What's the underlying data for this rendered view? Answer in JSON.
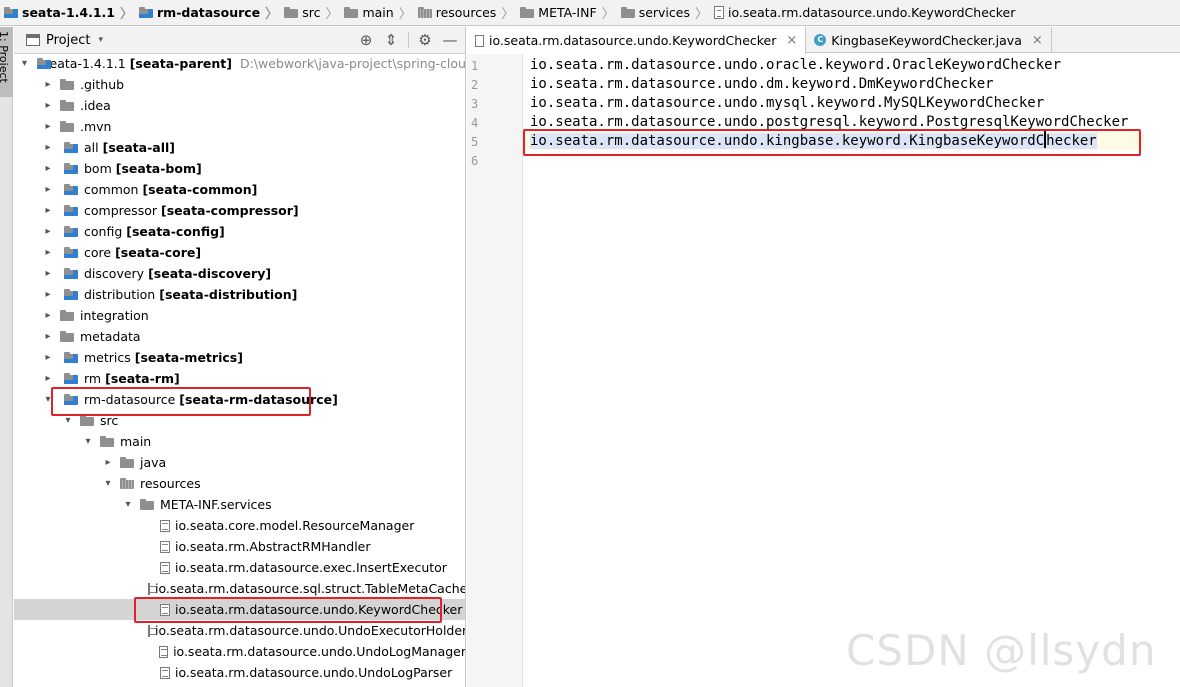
{
  "breadcrumb": [
    {
      "label": "seata-1.4.1.1",
      "icon": "module-folder-icon",
      "bold": true
    },
    {
      "label": "rm-datasource",
      "icon": "module-folder-icon",
      "bold": true
    },
    {
      "label": "src",
      "icon": "folder-icon",
      "bold": false
    },
    {
      "label": "main",
      "icon": "folder-icon",
      "bold": false
    },
    {
      "label": "resources",
      "icon": "resources-folder-icon",
      "bold": false
    },
    {
      "label": "META-INF",
      "icon": "folder-icon",
      "bold": false
    },
    {
      "label": "services",
      "icon": "folder-icon",
      "bold": false
    },
    {
      "label": "io.seata.rm.datasource.undo.KeywordChecker",
      "icon": "file-icon",
      "bold": false
    }
  ],
  "side_tool": {
    "label": "1: Project"
  },
  "project_panel": {
    "title": "Project",
    "dropdown_glyph": "▾",
    "buttons": {
      "locate": "⊕",
      "collapse": "⇕",
      "settings": "⚙",
      "hide": "—"
    }
  },
  "tree": [
    {
      "arrow": "▾",
      "depth": 0,
      "name": "seata-1.4.1.1",
      "module": "[seata-parent]",
      "path": "D:\\webwork\\java-project\\spring-cloud-alibaba",
      "icon": "module"
    },
    {
      "arrow": "▸",
      "depth": 1,
      "name": ".github",
      "module": "",
      "path": "",
      "icon": "folder"
    },
    {
      "arrow": "▸",
      "depth": 1,
      "name": ".idea",
      "module": "",
      "path": "",
      "icon": "folder"
    },
    {
      "arrow": "▸",
      "depth": 1,
      "name": ".mvn",
      "module": "",
      "path": "",
      "icon": "folder"
    },
    {
      "arrow": "▸",
      "depth": 1,
      "name": "all",
      "module": "[seata-all]",
      "path": "",
      "icon": "module"
    },
    {
      "arrow": "▸",
      "depth": 1,
      "name": "bom",
      "module": "[seata-bom]",
      "path": "",
      "icon": "module"
    },
    {
      "arrow": "▸",
      "depth": 1,
      "name": "common",
      "module": "[seata-common]",
      "path": "",
      "icon": "module"
    },
    {
      "arrow": "▸",
      "depth": 1,
      "name": "compressor",
      "module": "[seata-compressor]",
      "path": "",
      "icon": "module"
    },
    {
      "arrow": "▸",
      "depth": 1,
      "name": "config",
      "module": "[seata-config]",
      "path": "",
      "icon": "module"
    },
    {
      "arrow": "▸",
      "depth": 1,
      "name": "core",
      "module": "[seata-core]",
      "path": "",
      "icon": "module"
    },
    {
      "arrow": "▸",
      "depth": 1,
      "name": "discovery",
      "module": "[seata-discovery]",
      "path": "",
      "icon": "module"
    },
    {
      "arrow": "▸",
      "depth": 1,
      "name": "distribution",
      "module": "[seata-distribution]",
      "path": "",
      "icon": "module"
    },
    {
      "arrow": "▸",
      "depth": 1,
      "name": "integration",
      "module": "",
      "path": "",
      "icon": "folder"
    },
    {
      "arrow": "▸",
      "depth": 1,
      "name": "metadata",
      "module": "",
      "path": "",
      "icon": "folder"
    },
    {
      "arrow": "▸",
      "depth": 1,
      "name": "metrics",
      "module": "[seata-metrics]",
      "path": "",
      "icon": "module"
    },
    {
      "arrow": "▸",
      "depth": 1,
      "name": "rm",
      "module": "[seata-rm]",
      "path": "",
      "icon": "module"
    },
    {
      "arrow": "▾",
      "depth": 1,
      "name": "rm-datasource",
      "module": "[seata-rm-datasource]",
      "path": "",
      "icon": "module"
    },
    {
      "arrow": "▾",
      "depth": 2,
      "name": "src",
      "module": "",
      "path": "",
      "icon": "folder"
    },
    {
      "arrow": "▾",
      "depth": 3,
      "name": "main",
      "module": "",
      "path": "",
      "icon": "folder"
    },
    {
      "arrow": "▸",
      "depth": 4,
      "name": "java",
      "module": "",
      "path": "",
      "icon": "source"
    },
    {
      "arrow": "▾",
      "depth": 4,
      "name": "resources",
      "module": "",
      "path": "",
      "icon": "resources"
    },
    {
      "arrow": "▾",
      "depth": 5,
      "name": "META-INF.services",
      "module": "",
      "path": "",
      "icon": "folder"
    },
    {
      "arrow": "",
      "depth": 6,
      "name": "io.seata.core.model.ResourceManager",
      "module": "",
      "path": "",
      "icon": "file"
    },
    {
      "arrow": "",
      "depth": 6,
      "name": "io.seata.rm.AbstractRMHandler",
      "module": "",
      "path": "",
      "icon": "file"
    },
    {
      "arrow": "",
      "depth": 6,
      "name": "io.seata.rm.datasource.exec.InsertExecutor",
      "module": "",
      "path": "",
      "icon": "file"
    },
    {
      "arrow": "",
      "depth": 6,
      "name": "io.seata.rm.datasource.sql.struct.TableMetaCache",
      "module": "",
      "path": "",
      "icon": "file"
    },
    {
      "arrow": "",
      "depth": 6,
      "name": "io.seata.rm.datasource.undo.KeywordChecker",
      "module": "",
      "path": "",
      "icon": "file",
      "selected": true
    },
    {
      "arrow": "",
      "depth": 6,
      "name": "io.seata.rm.datasource.undo.UndoExecutorHolder",
      "module": "",
      "path": "",
      "icon": "file"
    },
    {
      "arrow": "",
      "depth": 6,
      "name": "io.seata.rm.datasource.undo.UndoLogManager",
      "module": "",
      "path": "",
      "icon": "file"
    },
    {
      "arrow": "",
      "depth": 6,
      "name": "io.seata.rm.datasource.undo.UndoLogParser",
      "module": "",
      "path": "",
      "icon": "file"
    }
  ],
  "editor": {
    "tabs": [
      {
        "label": "io.seata.rm.datasource.undo.KeywordChecker",
        "close": "×",
        "active": true
      },
      {
        "label": "KingbaseKeywordChecker.java",
        "close": "×",
        "active": false,
        "class_letter": "C"
      }
    ],
    "line_numbers": [
      "1",
      "2",
      "3",
      "4",
      "5",
      "6"
    ],
    "lines": [
      "io.seata.rm.datasource.undo.oracle.keyword.OracleKeywordChecker",
      "io.seata.rm.datasource.undo.dm.keyword.DmKeywordChecker",
      "io.seata.rm.datasource.undo.mysql.keyword.MySQLKeywordChecker",
      "io.seata.rm.datasource.undo.postgresql.keyword.PostgresqlKeywordChecker",
      "io.seata.rm.datasource.undo.kingbase.keyword.KingbaseKeywordChecker",
      ""
    ]
  },
  "colors": {
    "highlight_box": "#e0222a",
    "selection": "#dce5f7",
    "tree_selected": "#d4d4d4"
  },
  "watermark": "CSDN @llsydn"
}
